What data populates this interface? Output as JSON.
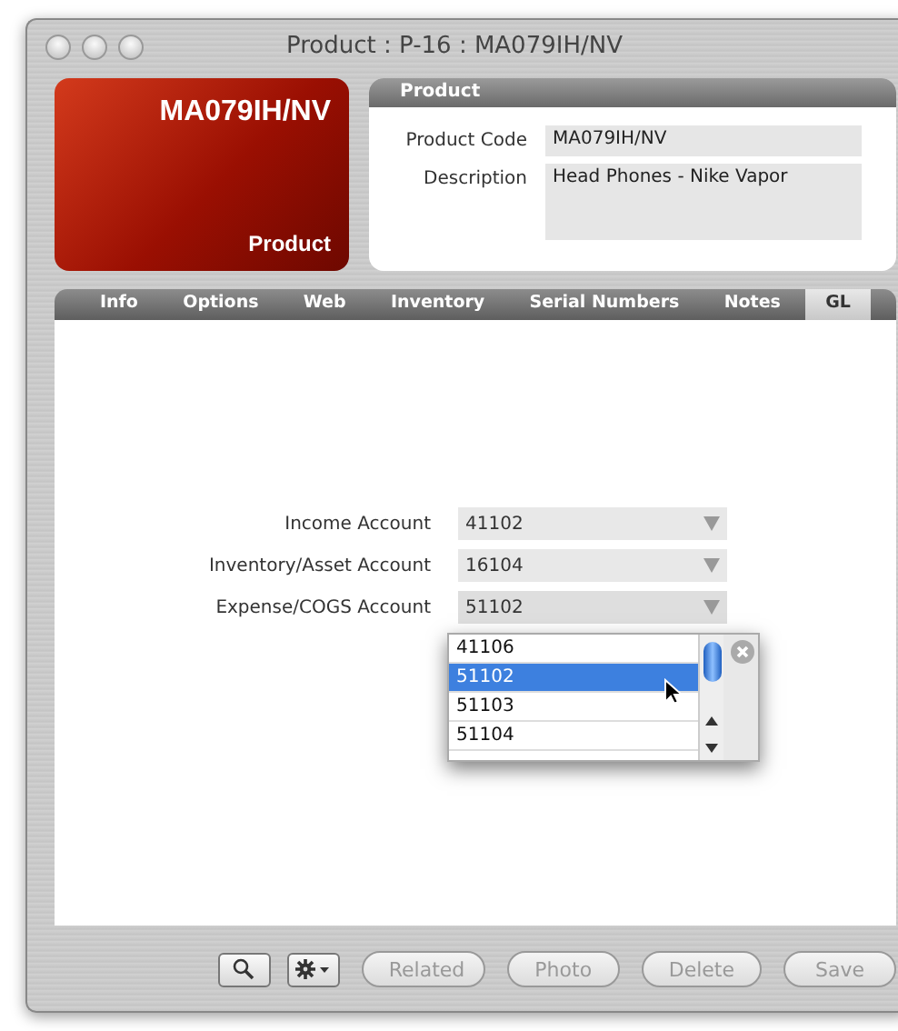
{
  "window": {
    "title": "Product : P-16 : MA079IH/NV"
  },
  "badge": {
    "code": "MA079IH/NV",
    "label": "Product"
  },
  "product_panel": {
    "title": "Product",
    "fields": [
      {
        "label": "Product Code",
        "value": "MA079IH/NV",
        "kind": "line"
      },
      {
        "label": "Description",
        "value": "Head Phones - Nike Vapor",
        "kind": "area"
      }
    ]
  },
  "tabs": [
    {
      "label": "Info",
      "selected": false
    },
    {
      "label": "Options",
      "selected": false
    },
    {
      "label": "Web",
      "selected": false
    },
    {
      "label": "Inventory",
      "selected": false
    },
    {
      "label": "Serial Numbers",
      "selected": false
    },
    {
      "label": "Notes",
      "selected": false
    },
    {
      "label": "GL",
      "selected": true
    }
  ],
  "gl_fields": [
    {
      "label": "Income Account",
      "value": "41102",
      "expanded": false
    },
    {
      "label": "Inventory/Asset Account",
      "value": "16104",
      "expanded": false
    },
    {
      "label": "Expense/COGS Account",
      "value": "51102",
      "expanded": true
    }
  ],
  "dropdown_options": [
    {
      "label": "41106",
      "selected": false
    },
    {
      "label": "51102",
      "selected": true
    },
    {
      "label": "51103",
      "selected": false
    },
    {
      "label": "51104",
      "selected": false
    }
  ],
  "toolbar": [
    {
      "kind": "search",
      "disabled": false
    },
    {
      "kind": "action",
      "disabled": false
    },
    {
      "kind": "text",
      "label": "Related",
      "disabled": true
    },
    {
      "kind": "text",
      "label": "Photo",
      "disabled": true
    },
    {
      "kind": "text",
      "label": "Delete",
      "disabled": true
    },
    {
      "kind": "text",
      "label": "Save",
      "disabled": true
    }
  ]
}
